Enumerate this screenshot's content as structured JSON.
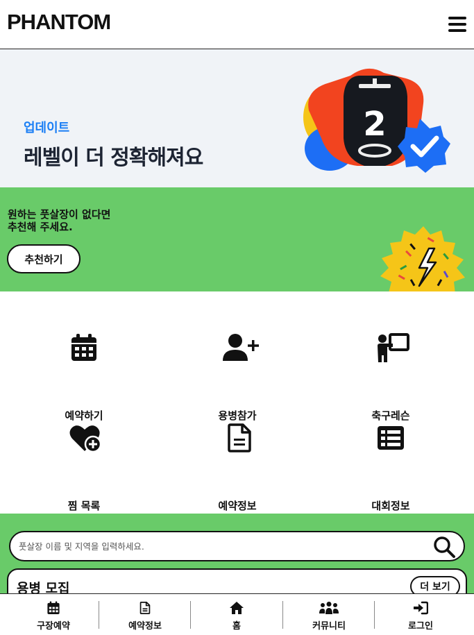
{
  "header": {
    "logo": "PHANTOM",
    "menu_icon": "hamburger-menu-icon"
  },
  "update_banner": {
    "tag": "업데이트",
    "title": "레벨이 더 정확해져요",
    "art_number": "2",
    "colors": {
      "tag": "#1a7ef5",
      "star": "#f2441f",
      "blue": "#1d6ef5",
      "yellow": "#f5c518"
    }
  },
  "recommend_banner": {
    "line1": "원하는 풋살장이 없다면",
    "line2": "추천해 주세요.",
    "button_label": "추천하기",
    "background": "#69cb69"
  },
  "grid": {
    "items": [
      {
        "label": "예약하기",
        "icon": "calendar-icon"
      },
      {
        "label": "용병참가",
        "icon": "user-plus-icon"
      },
      {
        "label": "축구레슨",
        "icon": "teacher-board-icon"
      },
      {
        "label": "찜 목록",
        "icon": "heart-plus-icon"
      },
      {
        "label": "예약정보",
        "icon": "document-icon"
      },
      {
        "label": "대회정보",
        "icon": "list-table-icon"
      }
    ]
  },
  "search": {
    "placeholder": "풋살장 이름 및 지역을 입력하세요.",
    "icon": "search-icon"
  },
  "recruit": {
    "title": "용병 모집",
    "more_label": "더 보기"
  },
  "bottom_nav": {
    "items": [
      {
        "label": "구장예약",
        "icon": "calendar-icon"
      },
      {
        "label": "예약정보",
        "icon": "document-icon"
      },
      {
        "label": "홈",
        "icon": "home-icon"
      },
      {
        "label": "커뮤니티",
        "icon": "users-icon"
      },
      {
        "label": "로그인",
        "icon": "login-icon"
      }
    ]
  }
}
